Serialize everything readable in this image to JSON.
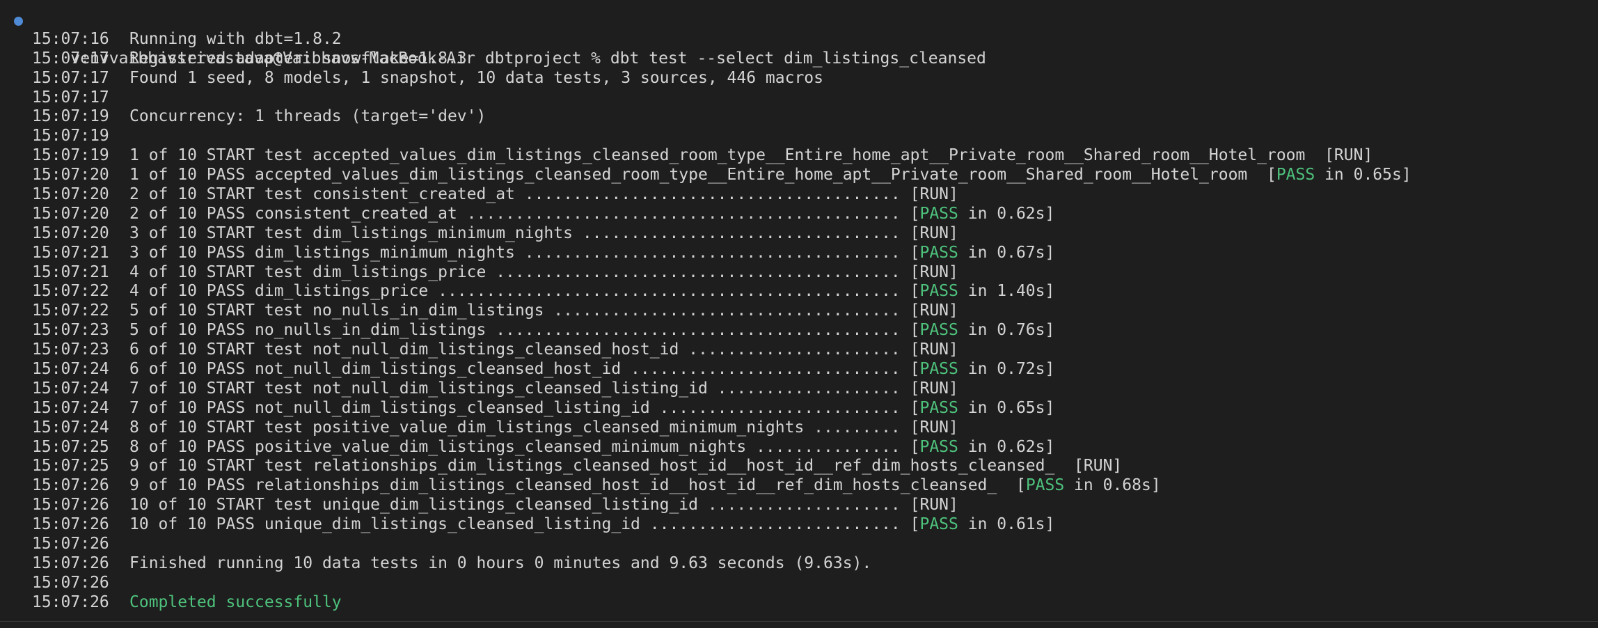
{
  "prompt": {
    "text": "venvvaibhavsrivastava@Vaibhavs-MacBook-Air dbtproject % dbt test --select dim_listings_cleansed"
  },
  "colors": {
    "background": "#1e1e1e",
    "text": "#d4d4d4",
    "pass_green": "#4ec27c",
    "prompt_dot": "#4f8ad6"
  },
  "lines": [
    {
      "ts": "15:07:16",
      "msg": "Running with dbt=1.8.2"
    },
    {
      "ts": "15:07:17",
      "msg": "Registered adapter: snowflake=1.8.3"
    },
    {
      "ts": "15:07:17",
      "msg": "Found 1 seed, 8 models, 1 snapshot, 10 data tests, 3 sources, 446 macros"
    },
    {
      "ts": "15:07:17",
      "msg": ""
    },
    {
      "ts": "15:07:19",
      "msg": "Concurrency: 1 threads (target='dev')"
    },
    {
      "ts": "15:07:19",
      "msg": ""
    },
    {
      "ts": "15:07:19",
      "msg": "1 of 10 START test accepted_values_dim_listings_cleansed_room_type__Entire_home_apt__Private_room__Shared_room__Hotel_room  ",
      "status": "[RUN]"
    },
    {
      "ts": "15:07:20",
      "msg": "1 of 10 PASS accepted_values_dim_listings_cleansed_room_type__Entire_home_apt__Private_room__Shared_room__Hotel_room  ",
      "pass_time": "in 0.65s]"
    },
    {
      "ts": "15:07:20",
      "msg": "2 of 10 START test consistent_created_at ....................................... ",
      "status": "[RUN]"
    },
    {
      "ts": "15:07:20",
      "msg": "2 of 10 PASS consistent_created_at ............................................. ",
      "pass_time": "in 0.62s]"
    },
    {
      "ts": "15:07:20",
      "msg": "3 of 10 START test dim_listings_minimum_nights ................................. ",
      "status": "[RUN]"
    },
    {
      "ts": "15:07:21",
      "msg": "3 of 10 PASS dim_listings_minimum_nights ....................................... ",
      "pass_time": "in 0.67s]"
    },
    {
      "ts": "15:07:21",
      "msg": "4 of 10 START test dim_listings_price .......................................... ",
      "status": "[RUN]"
    },
    {
      "ts": "15:07:22",
      "msg": "4 of 10 PASS dim_listings_price ................................................ ",
      "pass_time": "in 1.40s]"
    },
    {
      "ts": "15:07:22",
      "msg": "5 of 10 START test no_nulls_in_dim_listings .................................... ",
      "status": "[RUN]"
    },
    {
      "ts": "15:07:23",
      "msg": "5 of 10 PASS no_nulls_in_dim_listings .......................................... ",
      "pass_time": "in 0.76s]"
    },
    {
      "ts": "15:07:23",
      "msg": "6 of 10 START test not_null_dim_listings_cleansed_host_id ...................... ",
      "status": "[RUN]"
    },
    {
      "ts": "15:07:24",
      "msg": "6 of 10 PASS not_null_dim_listings_cleansed_host_id ............................ ",
      "pass_time": "in 0.72s]"
    },
    {
      "ts": "15:07:24",
      "msg": "7 of 10 START test not_null_dim_listings_cleansed_listing_id ................... ",
      "status": "[RUN]"
    },
    {
      "ts": "15:07:24",
      "msg": "7 of 10 PASS not_null_dim_listings_cleansed_listing_id ......................... ",
      "pass_time": "in 0.65s]"
    },
    {
      "ts": "15:07:24",
      "msg": "8 of 10 START test positive_value_dim_listings_cleansed_minimum_nights ......... ",
      "status": "[RUN]"
    },
    {
      "ts": "15:07:25",
      "msg": "8 of 10 PASS positive_value_dim_listings_cleansed_minimum_nights ............... ",
      "pass_time": "in 0.62s]"
    },
    {
      "ts": "15:07:25",
      "msg": "9 of 10 START test relationships_dim_listings_cleansed_host_id__host_id__ref_dim_hosts_cleansed_  ",
      "status": "[RUN]"
    },
    {
      "ts": "15:07:26",
      "msg": "9 of 10 PASS relationships_dim_listings_cleansed_host_id__host_id__ref_dim_hosts_cleansed_  ",
      "pass_time": "in 0.68s]"
    },
    {
      "ts": "15:07:26",
      "msg": "10 of 10 START test unique_dim_listings_cleansed_listing_id .................... ",
      "status": "[RUN]"
    },
    {
      "ts": "15:07:26",
      "msg": "10 of 10 PASS unique_dim_listings_cleansed_listing_id .......................... ",
      "pass_time": "in 0.61s]"
    },
    {
      "ts": "15:07:26",
      "msg": ""
    },
    {
      "ts": "15:07:26",
      "msg": "Finished running 10 data tests in 0 hours 0 minutes and 9.63 seconds (9.63s)."
    },
    {
      "ts": "15:07:26",
      "msg": ""
    },
    {
      "ts": "15:07:26",
      "msg": "",
      "success": "Completed successfully"
    }
  ],
  "pass_label": "PASS"
}
